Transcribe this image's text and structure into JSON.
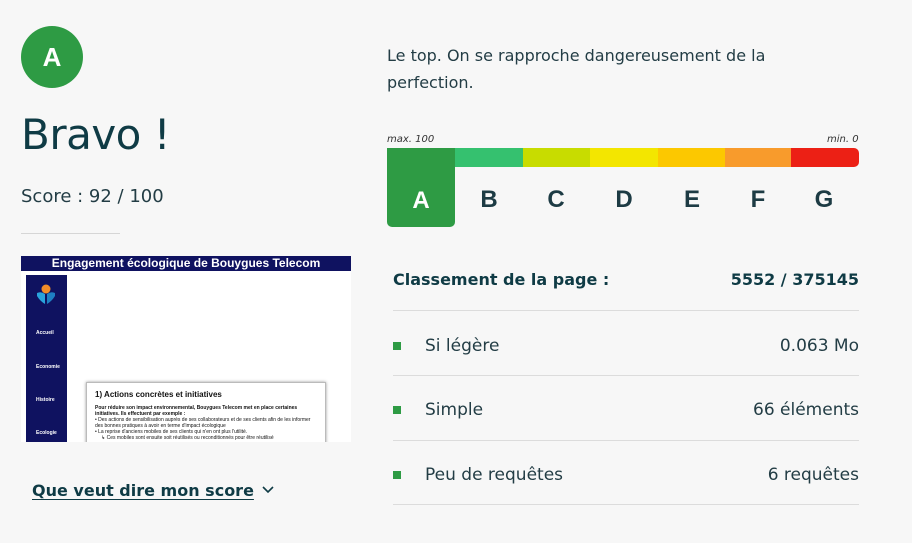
{
  "grade": "A",
  "headline": "Bravo !",
  "score_text": "Score : 92 / 100",
  "preview": {
    "title": "Engagement écologique de Bouygues Telecom",
    "sidebar": [
      "Accueil",
      "Economie",
      "Histoire",
      "Ecologie"
    ],
    "card_heading": "1) Actions concrètes et initiatives",
    "card_intro": "Pour réduire son impact environnemental, Bouygues Telecom met en place certaines initiatives. Ils effectuent par exemple :",
    "card_items": [
      "• Des actions de sensibilisation auprès de ses collaborateurs et de ses clients afin de les informer des bonnes pratiques à avoir en terme d'impact écologique",
      "• La reprise d'anciens mobiles de ses clients qui n'en ont plus l'utilité.",
      "↳ Ces mobiles sont ensuite soit réutilisés ou reconditionnés pour être réutilisé"
    ]
  },
  "score_link": "Que veut dire mon score",
  "description": "Le top. On se rapproche dangereusement de la perfection.",
  "scale": {
    "max_label": "max. 100",
    "min_label": "min. 0",
    "grades": [
      "A",
      "B",
      "C",
      "D",
      "E",
      "F",
      "G"
    ],
    "colors": [
      "#2e9b44",
      "#35c16f",
      "#c8dc00",
      "#f3e600",
      "#fcc800",
      "#f89b2c",
      "#ec2015"
    ]
  },
  "ranking": {
    "label": "Classement de la page :",
    "value": "5552 / 375145"
  },
  "metrics": [
    {
      "label": "Si légère",
      "value": "0.063 Mo"
    },
    {
      "label": "Simple",
      "value": "66 éléments"
    },
    {
      "label": "Peu de requêtes",
      "value": "6 requêtes"
    }
  ]
}
